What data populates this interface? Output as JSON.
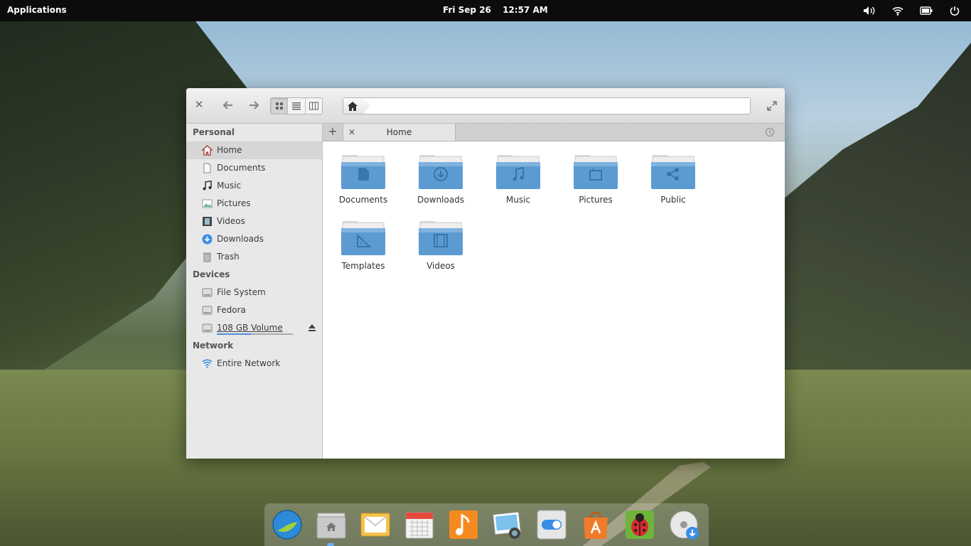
{
  "top_panel": {
    "applications_label": "Applications",
    "date": "Fri Sep 26",
    "time": "12:57 AM",
    "tray_icons": [
      "volume-icon",
      "wifi-icon",
      "battery-icon",
      "power-icon"
    ]
  },
  "window": {
    "tab_label": "Home",
    "colors": {
      "folder_top": "#a9cdeb",
      "folder_body": "#5c9bd1",
      "selection": "#d6d6d6"
    }
  },
  "sidebar": {
    "sections": [
      {
        "heading": "Personal",
        "items": [
          {
            "label": "Home",
            "icon": "home-icon",
            "selected": true
          },
          {
            "label": "Documents",
            "icon": "document-icon"
          },
          {
            "label": "Music",
            "icon": "music-icon"
          },
          {
            "label": "Pictures",
            "icon": "pictures-icon"
          },
          {
            "label": "Videos",
            "icon": "video-icon"
          },
          {
            "label": "Downloads",
            "icon": "download-icon"
          },
          {
            "label": "Trash",
            "icon": "trash-icon"
          }
        ]
      },
      {
        "heading": "Devices",
        "items": [
          {
            "label": "File System",
            "icon": "drive-icon"
          },
          {
            "label": "Fedora",
            "icon": "drive-icon"
          },
          {
            "label": "108 GB Volume",
            "icon": "drive-icon",
            "usage_fraction": 0.45
          }
        ]
      },
      {
        "heading": "Network",
        "items": [
          {
            "label": "Entire Network",
            "icon": "network-icon"
          }
        ]
      }
    ]
  },
  "files": [
    {
      "label": "Documents",
      "emblem": "document"
    },
    {
      "label": "Downloads",
      "emblem": "download"
    },
    {
      "label": "Music",
      "emblem": "music"
    },
    {
      "label": "Pictures",
      "emblem": "pictures"
    },
    {
      "label": "Public",
      "emblem": "share"
    },
    {
      "label": "Templates",
      "emblem": "template"
    },
    {
      "label": "Videos",
      "emblem": "video"
    }
  ],
  "dock": {
    "apps": [
      "browser-icon",
      "files-icon",
      "mail-icon",
      "calendar-icon",
      "music-player-icon",
      "photos-icon",
      "settings-icon",
      "app-store-icon",
      "bug-reporter-icon",
      "disc-installer-icon"
    ]
  }
}
